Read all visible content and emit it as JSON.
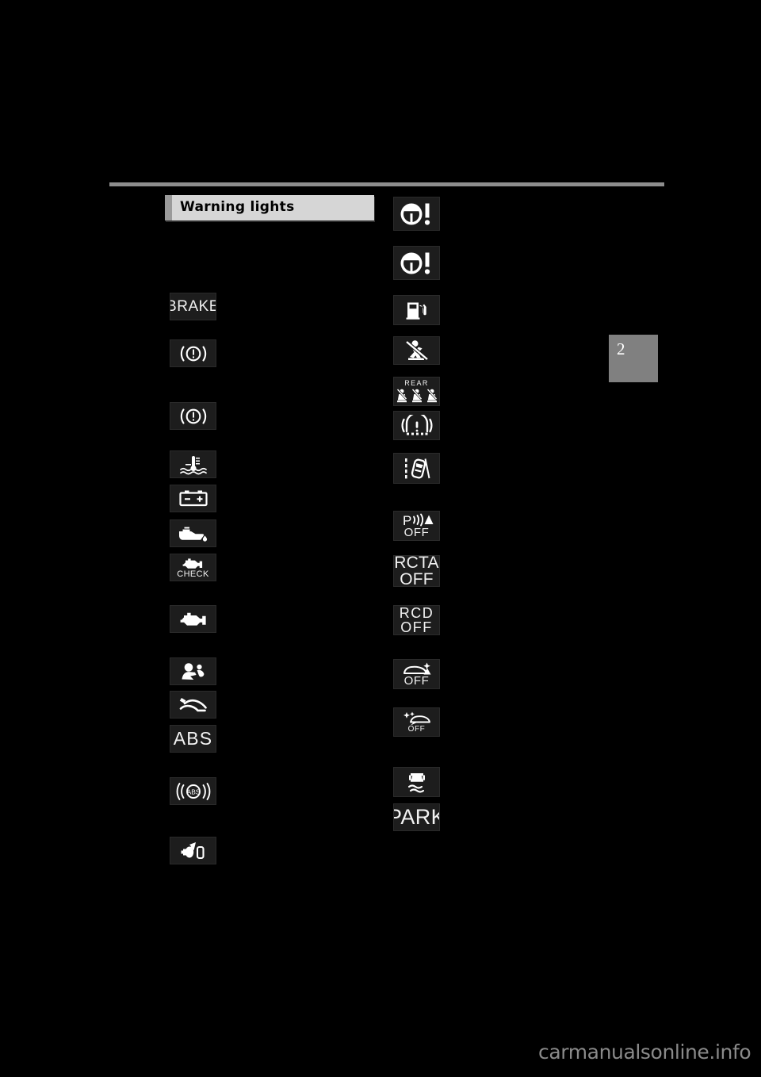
{
  "document": {
    "type": "vehicle owner's manual page",
    "chapter_tab": "2",
    "section_title": "Warning lights",
    "footer_watermark": "carmanualsonline.info",
    "background_color": "#000000",
    "tile_color": "#1d1d1d",
    "glyph_color": "#ffffff",
    "title_bar_color": "#d6d6d6",
    "title_accent_color": "#9a9a9a",
    "rule_color": "#8d8d8d",
    "tab_color": "#808080"
  },
  "left_column": [
    {
      "id": "brake-system-warning",
      "icon": "brake-text-icon",
      "label": "BRAKE"
    },
    {
      "id": "brake-warning-circle-1",
      "icon": "brake-exclamation-icon",
      "label": ""
    },
    {
      "id": "brake-warning-circle-2",
      "icon": "brake-exclamation-icon",
      "label": ""
    },
    {
      "id": "engine-coolant-temp",
      "icon": "coolant-temperature-icon",
      "label": ""
    },
    {
      "id": "charging-system",
      "icon": "battery-icon",
      "label": ""
    },
    {
      "id": "low-oil-pressure",
      "icon": "oil-can-icon",
      "label": ""
    },
    {
      "id": "engine-check",
      "icon": "engine-check-icon",
      "label": "CHECK"
    },
    {
      "id": "malfunction-indicator",
      "icon": "engine-icon",
      "label": ""
    },
    {
      "id": "srs-airbag",
      "icon": "airbag-icon",
      "label": ""
    },
    {
      "id": "seat-belt-pretensioner",
      "icon": "pretensioner-icon",
      "label": ""
    },
    {
      "id": "abs-text",
      "icon": "abs-text-icon",
      "label": "ABS"
    },
    {
      "id": "abs-bracket",
      "icon": "abs-bracket-icon",
      "label": "ABS"
    },
    {
      "id": "brake-pad-wear",
      "icon": "brake-pad-wear-icon",
      "label": ""
    }
  ],
  "right_column": [
    {
      "id": "eps-warning-1",
      "icon": "steering-wheel-alert-icon",
      "label": ""
    },
    {
      "id": "eps-warning-2",
      "icon": "steering-wheel-alert-icon",
      "label": ""
    },
    {
      "id": "low-fuel",
      "icon": "fuel-pump-icon",
      "label": ""
    },
    {
      "id": "driver-seat-belt-reminder",
      "icon": "seat-belt-icon",
      "label": ""
    },
    {
      "id": "rear-seat-belt-reminder",
      "icon": "rear-seat-belt-icon",
      "label": "REAR"
    },
    {
      "id": "tire-pressure-warning",
      "icon": "tire-pressure-icon",
      "label": ""
    },
    {
      "id": "lane-departure-alert",
      "icon": "lane-departure-icon",
      "label": ""
    },
    {
      "id": "parking-assist-off",
      "icon": "parking-sensor-off-icon",
      "label": "OFF",
      "prefix": "P"
    },
    {
      "id": "rcta-off",
      "icon": "rcta-off-icon",
      "label": "RCTA\nOFF"
    },
    {
      "id": "rcd-off",
      "icon": "rcd-off-icon",
      "label": "RCD\nOFF"
    },
    {
      "id": "pksb-off",
      "icon": "pksb-rear-off-icon",
      "label": "OFF"
    },
    {
      "id": "pcs-off",
      "icon": "pcs-front-off-icon",
      "label": "OFF"
    },
    {
      "id": "vsc-skid-control",
      "icon": "skid-control-icon",
      "label": ""
    },
    {
      "id": "park-indicator",
      "icon": "park-text-icon",
      "label": "PARK"
    }
  ],
  "labels": {
    "brake": "BRAKE",
    "abs": "ABS",
    "check": "CHECK",
    "rear": "REAR",
    "off": "OFF",
    "p": "P",
    "rcta_line1": "RCTA",
    "rcta_line2": "OFF",
    "rcd_line1": "RCD",
    "rcd_line2": "OFF",
    "park": "PARK"
  }
}
